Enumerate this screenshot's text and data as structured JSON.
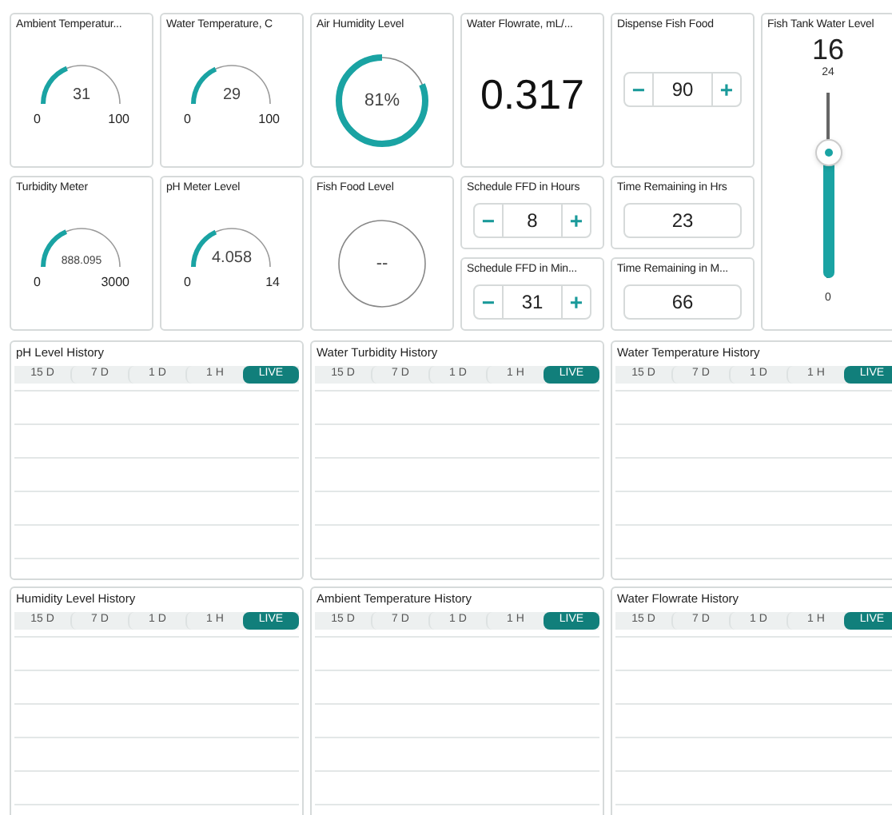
{
  "cards": [
    {
      "kind": "gauge",
      "title": "Ambient Temperatur...",
      "value": "31",
      "min": "0",
      "max": "100",
      "level": 0.31
    },
    {
      "kind": "gauge",
      "title": "Water Temperature, C",
      "value": "29",
      "min": "0",
      "max": "100",
      "level": 0.29
    },
    {
      "kind": "ring",
      "title": "Air Humidity Level",
      "value": "81%",
      "level": 0.81
    },
    {
      "kind": "readout",
      "title": "Water Flowrate, mL/...",
      "value": "0.317"
    },
    {
      "kind": "stepper",
      "title": "Dispense Fish Food",
      "value": "90",
      "minus": "−",
      "plus": "+"
    },
    {
      "kind": "slider",
      "title": "Fish Tank Water Level",
      "value": "16",
      "max": "24",
      "min": "0",
      "level": 0.667
    },
    {
      "kind": "gauge",
      "title": "Turbidity Meter",
      "value": "888.095",
      "min": "0",
      "max": "3000",
      "level": 0.3
    },
    {
      "kind": "gauge",
      "title": "pH Meter Level",
      "value": "4.058",
      "min": "0",
      "max": "14",
      "level": 0.29
    },
    {
      "kind": "ring",
      "title": "Fish Food Level",
      "value": "--"
    },
    {
      "kind": "stepper",
      "title": "Schedule FFD in Hours",
      "value": "8",
      "minus": "−",
      "plus": "+"
    },
    {
      "kind": "display",
      "title": "Time Remaining in Hrs",
      "value": "23"
    },
    {
      "kind": "stepper",
      "title": "Schedule FFD in Min...",
      "value": "31",
      "minus": "−",
      "plus": "+"
    },
    {
      "kind": "display",
      "title": "Time Remaining in M...",
      "value": "66"
    }
  ],
  "history": [
    {
      "title": "pH Level History",
      "ranges": [
        {
          "label": "15 D",
          "selected": false
        },
        {
          "label": "7 D",
          "selected": false
        },
        {
          "label": "1 D",
          "selected": false
        },
        {
          "label": "1 H",
          "selected": false
        },
        {
          "label": "LIVE",
          "selected": true
        }
      ]
    },
    {
      "title": "Water Turbidity History",
      "ranges": [
        {
          "label": "15 D",
          "selected": false
        },
        {
          "label": "7 D",
          "selected": false
        },
        {
          "label": "1 D",
          "selected": false
        },
        {
          "label": "1 H",
          "selected": false
        },
        {
          "label": "LIVE",
          "selected": true
        }
      ]
    },
    {
      "title": "Water Temperature History",
      "ranges": [
        {
          "label": "15 D",
          "selected": false
        },
        {
          "label": "7 D",
          "selected": false
        },
        {
          "label": "1 D",
          "selected": false
        },
        {
          "label": "1 H",
          "selected": false
        },
        {
          "label": "LIVE",
          "selected": true
        }
      ]
    },
    {
      "title": "Humidity Level History",
      "ranges": [
        {
          "label": "15 D",
          "selected": false
        },
        {
          "label": "7 D",
          "selected": false
        },
        {
          "label": "1 D",
          "selected": false
        },
        {
          "label": "1 H",
          "selected": false
        },
        {
          "label": "LIVE",
          "selected": true
        }
      ]
    },
    {
      "title": "Ambient Temperature History",
      "ranges": [
        {
          "label": "15 D",
          "selected": false
        },
        {
          "label": "7 D",
          "selected": false
        },
        {
          "label": "1 D",
          "selected": false
        },
        {
          "label": "1 H",
          "selected": false
        },
        {
          "label": "LIVE",
          "selected": true
        }
      ]
    },
    {
      "title": "Water Flowrate History",
      "ranges": [
        {
          "label": "15 D",
          "selected": false
        },
        {
          "label": "7 D",
          "selected": false
        },
        {
          "label": "1 D",
          "selected": false
        },
        {
          "label": "1 H",
          "selected": false
        },
        {
          "label": "LIVE",
          "selected": true
        }
      ]
    }
  ]
}
